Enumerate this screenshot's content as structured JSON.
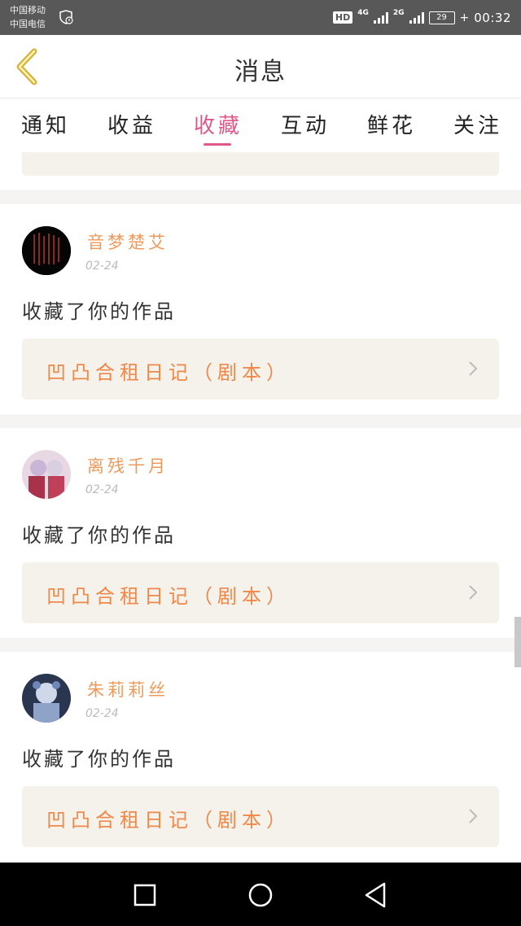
{
  "status_bar": {
    "carrier_1": "中国移动",
    "carrier_2": "中国电信",
    "hd": "HD",
    "net_1": "4G",
    "net_2": "2G",
    "battery": "29",
    "time": "00:32"
  },
  "header": {
    "title": "消息"
  },
  "tabs": [
    {
      "label": "通知"
    },
    {
      "label": "收益"
    },
    {
      "label": "收藏",
      "active": true
    },
    {
      "label": "互动"
    },
    {
      "label": "鲜花"
    },
    {
      "label": "关注"
    }
  ],
  "items": [
    {
      "user": "音梦楚艾",
      "date": "02-24",
      "action": "收藏了你的作品",
      "work": "凹凸合租日记（剧本）"
    },
    {
      "user": "离残千月",
      "date": "02-24",
      "action": "收藏了你的作品",
      "work": "凹凸合租日记（剧本）"
    },
    {
      "user": "朱莉莉丝",
      "date": "02-24",
      "action": "收藏了你的作品",
      "work": "凹凸合租日记（剧本）"
    }
  ],
  "colors": {
    "accent": "#e0588a",
    "orange": "#f0884a",
    "work_bg": "#f4f2ea"
  }
}
